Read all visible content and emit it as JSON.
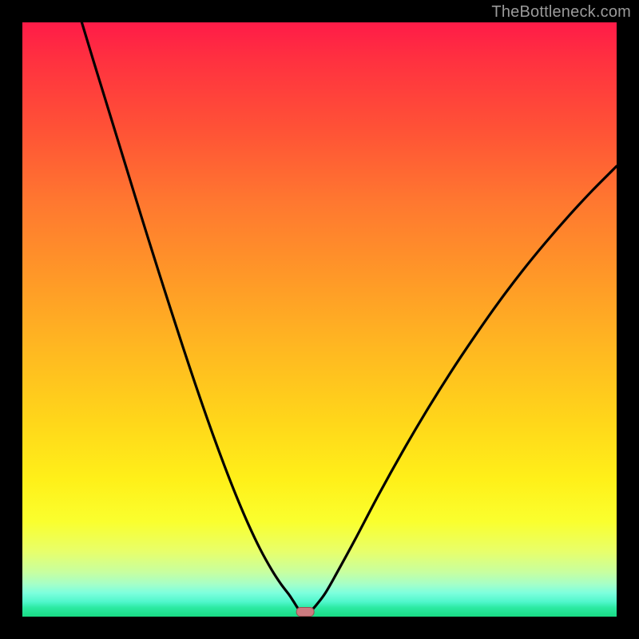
{
  "watermark": "TheBottleneck.com",
  "colors": {
    "curve_stroke": "#000000",
    "marker_fill": "#cd7b80",
    "marker_stroke": "#9a5052",
    "frame": "#000000"
  },
  "chart_data": {
    "type": "line",
    "title": "",
    "xlabel": "",
    "ylabel": "",
    "xlim": [
      0,
      100
    ],
    "ylim": [
      0,
      100
    ],
    "grid": false,
    "legend": false,
    "annotations": [],
    "curve_left": {
      "x": [
        10.0,
        12.0,
        14.0,
        16.0,
        18.0,
        20.0,
        22.0,
        24.0,
        26.0,
        28.0,
        30.0,
        32.0,
        34.0,
        36.0,
        38.0,
        40.0,
        42.0,
        43.5,
        44.8,
        45.6,
        46.1,
        46.5
      ],
      "y": [
        100.0,
        93.4,
        86.9,
        80.4,
        73.9,
        67.4,
        61.0,
        54.7,
        48.5,
        42.4,
        36.5,
        30.8,
        25.4,
        20.3,
        15.6,
        11.4,
        7.8,
        5.5,
        3.8,
        2.6,
        1.8,
        1.2
      ]
    },
    "curve_right": {
      "x": [
        48.8,
        49.5,
        51.0,
        53.0,
        56.0,
        60.0,
        64.0,
        68.0,
        72.0,
        76.0,
        80.0,
        84.0,
        88.0,
        92.0,
        96.0,
        100.0
      ],
      "y": [
        1.2,
        2.0,
        4.0,
        7.5,
        13.0,
        20.6,
        27.8,
        34.6,
        41.0,
        47.0,
        52.7,
        58.0,
        62.9,
        67.5,
        71.8,
        75.8
      ]
    },
    "marker": {
      "x": 47.6,
      "y": 0.8
    }
  }
}
